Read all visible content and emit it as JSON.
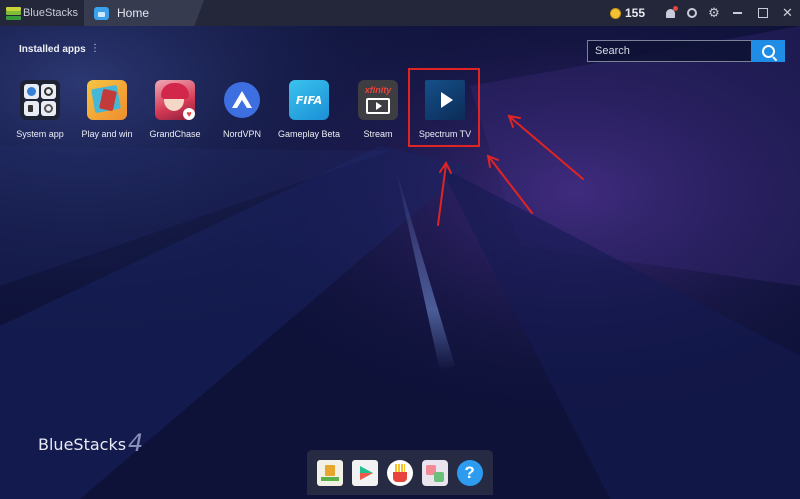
{
  "titlebar": {
    "brand": "BlueStacks",
    "tab_label": "Home",
    "coins": "155",
    "icons": [
      "bell-icon",
      "profile-ring-icon",
      "gear-icon"
    ],
    "window_controls": [
      "minimize-icon",
      "maximize-icon",
      "close-icon"
    ]
  },
  "main": {
    "section_title": "Installed apps",
    "search": {
      "placeholder": "Search"
    }
  },
  "apps": [
    {
      "label": "System app",
      "icon": "system-app-icon"
    },
    {
      "label": "Play and win",
      "icon": "play-and-win-icon"
    },
    {
      "label": "GrandChase",
      "icon": "grandchase-icon"
    },
    {
      "label": "NordVPN",
      "icon": "nordvpn-icon"
    },
    {
      "label": "Gameplay Beta",
      "icon": "fifa-icon",
      "icon_text": "FIFA"
    },
    {
      "label": "Stream",
      "icon": "xfinity-stream-icon",
      "icon_text": "xfinity"
    },
    {
      "label": "Spectrum TV",
      "icon": "spectrum-tv-icon",
      "highlighted": true
    }
  ],
  "footer": {
    "logo_text": "BlueStacks",
    "logo_version": "4"
  },
  "dock": [
    "download-icon",
    "play-store-icon",
    "fries-game-icon",
    "app-center-icon",
    "help-icon"
  ],
  "dock_help_glyph": "?",
  "colors": {
    "accent": "#1f8ce6",
    "highlight": "#e02424",
    "titlebar": "#232739",
    "background": "#0d1138"
  }
}
